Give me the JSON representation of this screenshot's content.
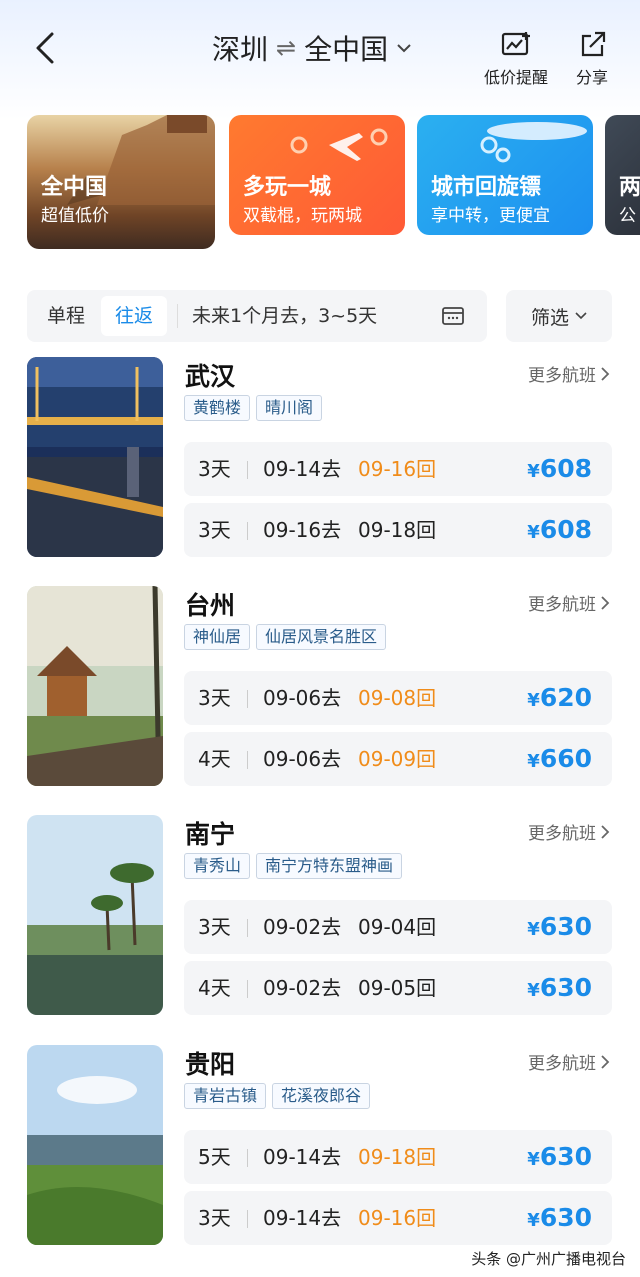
{
  "header": {
    "origin": "深圳",
    "swap_symbol": "⇌",
    "destination": "全中国",
    "price_alert_label": "低价提醒",
    "share_label": "分享"
  },
  "banners": [
    {
      "title": "全中国",
      "subtitle": "超值低价"
    },
    {
      "title": "多玩一城",
      "subtitle": "双截棍，玩两城"
    },
    {
      "title": "城市回旋镖",
      "subtitle": "享中转，更便宜"
    },
    {
      "title": "两",
      "subtitle": "公"
    }
  ],
  "filter": {
    "one_way": "单程",
    "round_trip": "往返",
    "date_range": "未来1个月去，3~5天",
    "screen": "筛选"
  },
  "destinations": [
    {
      "city": "武汉",
      "more": "更多航班",
      "tags": [
        "黄鹤楼",
        "晴川阁"
      ],
      "flights": [
        {
          "days": "3天",
          "go": "09-14去",
          "ret": "09-16回",
          "price": "608",
          "highlight": true
        },
        {
          "days": "3天",
          "go": "09-16去",
          "ret": "09-18回",
          "price": "608",
          "highlight": false
        }
      ]
    },
    {
      "city": "台州",
      "more": "更多航班",
      "tags": [
        "神仙居",
        "仙居风景名胜区"
      ],
      "flights": [
        {
          "days": "3天",
          "go": "09-06去",
          "ret": "09-08回",
          "price": "620",
          "highlight": true
        },
        {
          "days": "4天",
          "go": "09-06去",
          "ret": "09-09回",
          "price": "660",
          "highlight": true
        }
      ]
    },
    {
      "city": "南宁",
      "more": "更多航班",
      "tags": [
        "青秀山",
        "南宁方特东盟神画"
      ],
      "flights": [
        {
          "days": "3天",
          "go": "09-02去",
          "ret": "09-04回",
          "price": "630",
          "highlight": false
        },
        {
          "days": "4天",
          "go": "09-02去",
          "ret": "09-05回",
          "price": "630",
          "highlight": false
        }
      ]
    },
    {
      "city": "贵阳",
      "more": "更多航班",
      "tags": [
        "青岩古镇",
        "花溪夜郎谷"
      ],
      "flights": [
        {
          "days": "5天",
          "go": "09-14去",
          "ret": "09-18回",
          "price": "630",
          "highlight": true
        },
        {
          "days": "3天",
          "go": "09-14去",
          "ret": "09-16回",
          "price": "630",
          "highlight": true
        }
      ]
    }
  ],
  "currency_symbol": "¥",
  "watermark": "头条 @广州广播电视台",
  "colors": {
    "accent": "#1a8be8",
    "highlight": "#f08c1a"
  }
}
